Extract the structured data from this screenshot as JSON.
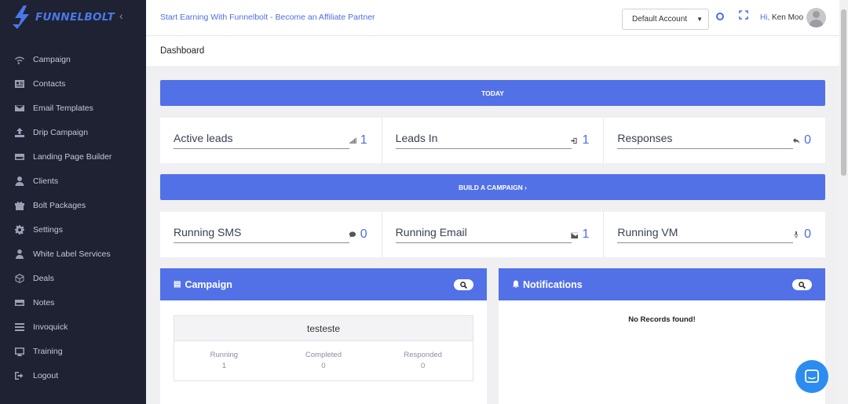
{
  "brand": {
    "name": "FUNNELBOLT",
    "collapse_glyph": "‹"
  },
  "sidebar": {
    "items": [
      {
        "label": "Campaign",
        "icon": "wifi-icon"
      },
      {
        "label": "Contacts",
        "icon": "contact-card-icon"
      },
      {
        "label": "Email Templates",
        "icon": "envelope-icon"
      },
      {
        "label": "Drip Campaign",
        "icon": "upload-icon"
      },
      {
        "label": "Landing Page Builder",
        "icon": "hdd-icon"
      },
      {
        "label": "Clients",
        "icon": "user-icon"
      },
      {
        "label": "Bolt Packages",
        "icon": "gift-icon"
      },
      {
        "label": "Settings",
        "icon": "cog-icon"
      },
      {
        "label": "White Label Services",
        "icon": "user-tie-icon"
      },
      {
        "label": "Deals",
        "icon": "cube-icon"
      },
      {
        "label": "Notes",
        "icon": "hdd-icon"
      },
      {
        "label": "Invoquick",
        "icon": "invoice-icon"
      },
      {
        "label": "Training",
        "icon": "chalkboard-icon"
      },
      {
        "label": "Logout",
        "icon": "sign-out-icon"
      }
    ]
  },
  "topbar": {
    "promo": "Start Earning With Funnelbolt - Become an Affiliate Partner",
    "account_select": "Default Account",
    "greeting_prefix": "Hi,",
    "user_name": "Ken Moo"
  },
  "page": {
    "title": "Dashboard"
  },
  "today_bar": "TODAY",
  "build_bar": "BUILD A CAMPAIGN ›",
  "stats_top": [
    {
      "label": "Active leads",
      "value": "1",
      "icon": "signal-icon"
    },
    {
      "label": "Leads In",
      "value": "1",
      "icon": "sign-in-icon"
    },
    {
      "label": "Responses",
      "value": "0",
      "icon": "reply-icon"
    }
  ],
  "stats_bottom": [
    {
      "label": "Running SMS",
      "value": "0",
      "icon": "comment-icon"
    },
    {
      "label": "Running Email",
      "value": "1",
      "icon": "envelope-icon"
    },
    {
      "label": "Running VM",
      "value": "0",
      "icon": "microphone-icon"
    }
  ],
  "campaign_panel": {
    "title": "Campaign",
    "campaign_name": "testeste",
    "metrics": [
      {
        "label": "Running",
        "value": "1"
      },
      {
        "label": "Completed",
        "value": "0"
      },
      {
        "label": "Responded",
        "value": "0"
      }
    ]
  },
  "notifications_panel": {
    "title": "Notifications",
    "empty_text": "No Records found!"
  },
  "colors": {
    "accent": "#5271e6",
    "sidebar_bg": "#1f2233",
    "chat": "#2d8cf0"
  }
}
